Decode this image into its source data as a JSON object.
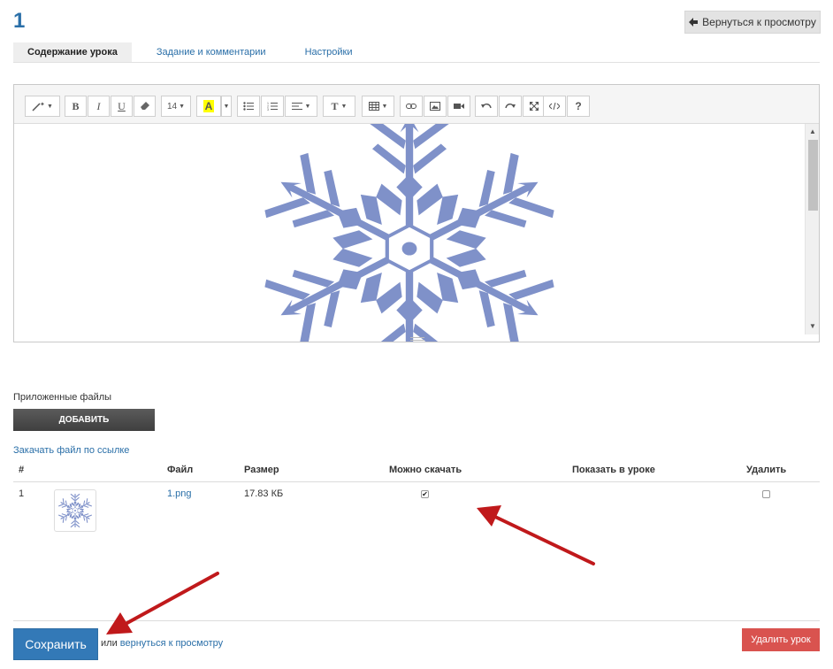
{
  "header": {
    "title": "1",
    "back_label": "Вернуться к просмотру"
  },
  "tabs": [
    {
      "label": "Содержание урока",
      "active": true
    },
    {
      "label": "Задание и комментарии",
      "active": false
    },
    {
      "label": "Настройки",
      "active": false
    }
  ],
  "toolbar": {
    "font_size": "14",
    "bold": "B",
    "italic": "I",
    "underline": "U",
    "highlight": "A",
    "text_style": "T",
    "help": "?"
  },
  "attachments": {
    "label": "Приложенные файлы",
    "add_label": "ДОБАВИТЬ",
    "url_link": "Закачать файл по ссылке",
    "columns": [
      "#",
      "Файл",
      "Размер",
      "Можно скачать",
      "Показать в уроке",
      "Удалить"
    ],
    "rows": [
      {
        "num": "1",
        "file": "1.png",
        "size": "17.83 КБ",
        "downloadable": true,
        "delete": false
      }
    ]
  },
  "footer": {
    "save_label": "Сохранить",
    "or_text": "или",
    "back_link": "вернуться к просмотру",
    "delete_label": "Удалить урок"
  },
  "colors": {
    "accent": "#3379b7",
    "danger": "#d9534f",
    "snowflake": "#7f91c9",
    "arrow": "#c0191b"
  }
}
